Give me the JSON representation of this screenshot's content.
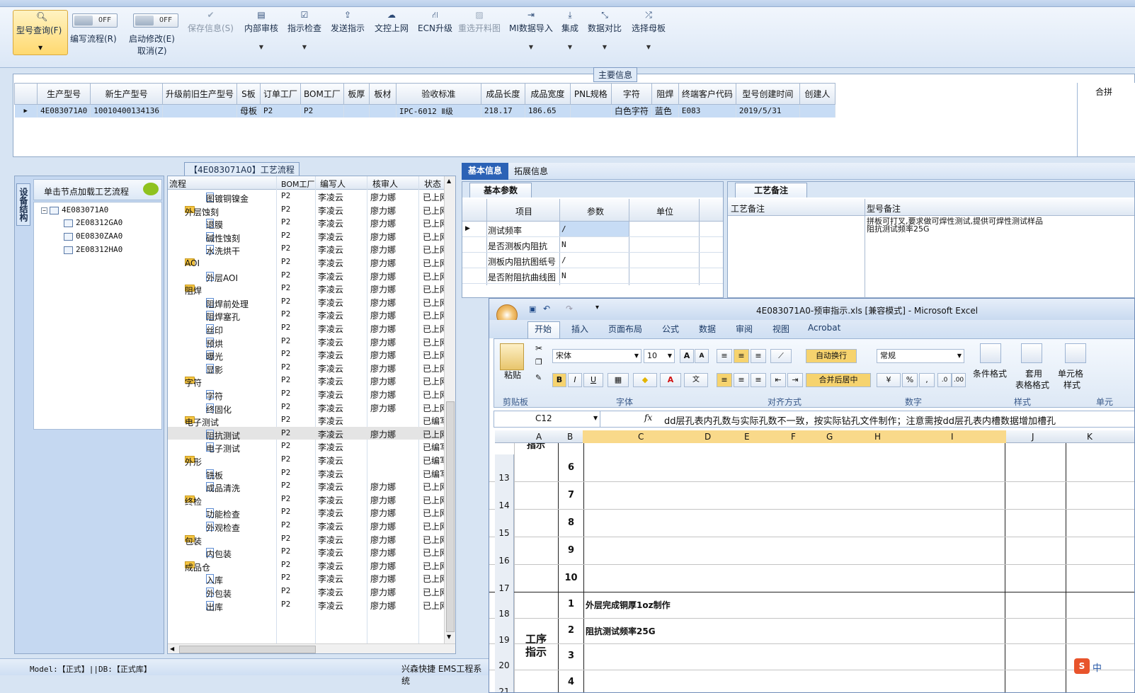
{
  "toolbar": {
    "query_label": "型号查询(F)",
    "toggle_off": "OFF",
    "write_flow": "编写流程(R)",
    "start_modify": "启动修改(E)",
    "cancel": "取消(Z)",
    "save_info": "保存信息(S)",
    "internal_review": "内部审核",
    "instr_check": "指示检查",
    "send_instr": "发送指示",
    "doc_upload": "文控上网",
    "ecn_upgrade": "ECN升级",
    "reselect_map": "重选开料图",
    "mi_import": "MI数据导入",
    "integrate": "集成",
    "data_compare": "数据对比",
    "select_mother": "选择母板"
  },
  "main_info": {
    "caption": "主要信息",
    "right_label": "合拼",
    "headers": [
      "生产型号",
      "新生产型号",
      "升级前旧生产型号",
      "S板",
      "订单工厂",
      "BOM工厂",
      "板厚",
      "板材",
      "验收标准",
      "成品长度",
      "成品宽度",
      "PNL规格",
      "字符",
      "阻焊",
      "终端客户代码",
      "型号创建时间",
      "创建人"
    ],
    "row": [
      "4E083071A0",
      "10010400134136",
      "",
      "母板",
      "P2",
      "P2",
      "",
      "",
      "IPC-6012 Ⅱ级",
      "218.17",
      "186.65",
      "",
      "白色字符",
      "蓝色",
      "E083",
      "2019/5/31",
      ""
    ]
  },
  "flow_caption": "【4E083071A0】工艺流程",
  "side": {
    "vtab": "设备结构",
    "hint": "单击节点加载工艺流程",
    "root": "4E083071A0",
    "children": [
      "2E08312GA0",
      "0E0830ZAA0",
      "2E08312HA0"
    ]
  },
  "proc": {
    "headers": [
      "流程",
      "BOM工厂",
      "编写人",
      "核审人",
      "状态"
    ],
    "rows": [
      {
        "t": "f",
        "n": "图镀铜镍金",
        "lvl": 2,
        "f": "P2",
        "w": "李凌云",
        "r": "廖力娜",
        "s": "已上网"
      },
      {
        "t": "g",
        "n": "外层蚀刻",
        "lvl": 1,
        "f": "P2",
        "w": "李凌云",
        "r": "廖力娜",
        "s": "已上网"
      },
      {
        "t": "f",
        "n": "退膜",
        "lvl": 2,
        "f": "P2",
        "w": "李凌云",
        "r": "廖力娜",
        "s": "已上网"
      },
      {
        "t": "f",
        "n": "碱性蚀刻",
        "lvl": 2,
        "f": "P2",
        "w": "李凌云",
        "r": "廖力娜",
        "s": "已上网"
      },
      {
        "t": "f",
        "n": "水洗烘干",
        "lvl": 2,
        "f": "P2",
        "w": "李凌云",
        "r": "廖力娜",
        "s": "已上网"
      },
      {
        "t": "g",
        "n": "AOI",
        "lvl": 1,
        "f": "P2",
        "w": "李凌云",
        "r": "廖力娜",
        "s": "已上网"
      },
      {
        "t": "f",
        "n": "外层AOI",
        "lvl": 2,
        "f": "P2",
        "w": "李凌云",
        "r": "廖力娜",
        "s": "已上网"
      },
      {
        "t": "g",
        "n": "阻焊",
        "lvl": 1,
        "f": "P2",
        "w": "李凌云",
        "r": "廖力娜",
        "s": "已上网"
      },
      {
        "t": "f",
        "n": "阻焊前处理",
        "lvl": 2,
        "f": "P2",
        "w": "李凌云",
        "r": "廖力娜",
        "s": "已上网"
      },
      {
        "t": "f",
        "n": "阻焊塞孔",
        "lvl": 2,
        "f": "P2",
        "w": "李凌云",
        "r": "廖力娜",
        "s": "已上网"
      },
      {
        "t": "f",
        "n": "丝印",
        "lvl": 2,
        "f": "P2",
        "w": "李凌云",
        "r": "廖力娜",
        "s": "已上网"
      },
      {
        "t": "f",
        "n": "预烘",
        "lvl": 2,
        "f": "P2",
        "w": "李凌云",
        "r": "廖力娜",
        "s": "已上网"
      },
      {
        "t": "f",
        "n": "曝光",
        "lvl": 2,
        "f": "P2",
        "w": "李凌云",
        "r": "廖力娜",
        "s": "已上网"
      },
      {
        "t": "f",
        "n": "显影",
        "lvl": 2,
        "f": "P2",
        "w": "李凌云",
        "r": "廖力娜",
        "s": "已上网"
      },
      {
        "t": "g",
        "n": "字符",
        "lvl": 1,
        "f": "P2",
        "w": "李凌云",
        "r": "廖力娜",
        "s": "已上网"
      },
      {
        "t": "f",
        "n": "字符",
        "lvl": 2,
        "f": "P2",
        "w": "李凌云",
        "r": "廖力娜",
        "s": "已上网"
      },
      {
        "t": "f",
        "n": "终固化",
        "lvl": 2,
        "f": "P2",
        "w": "李凌云",
        "r": "廖力娜",
        "s": "已上网"
      },
      {
        "t": "g",
        "n": "电子测试",
        "lvl": 1,
        "f": "P2",
        "w": "李凌云",
        "r": "",
        "s": "已编写"
      },
      {
        "t": "f",
        "n": "阻抗测试",
        "lvl": 2,
        "f": "P2",
        "w": "李凌云",
        "r": "廖力娜",
        "s": "已上网",
        "sel": true
      },
      {
        "t": "f",
        "n": "电子测试",
        "lvl": 2,
        "f": "P2",
        "w": "李凌云",
        "r": "",
        "s": "已编写"
      },
      {
        "t": "g",
        "n": "外形",
        "lvl": 1,
        "f": "P2",
        "w": "李凌云",
        "r": "",
        "s": "已编写"
      },
      {
        "t": "f",
        "n": "铣板",
        "lvl": 2,
        "f": "P2",
        "w": "李凌云",
        "r": "",
        "s": "已编写"
      },
      {
        "t": "f",
        "n": "成品清洗",
        "lvl": 2,
        "f": "P2",
        "w": "李凌云",
        "r": "廖力娜",
        "s": "已上网"
      },
      {
        "t": "g",
        "n": "终检",
        "lvl": 1,
        "f": "P2",
        "w": "李凌云",
        "r": "廖力娜",
        "s": "已上网"
      },
      {
        "t": "f",
        "n": "功能检查",
        "lvl": 2,
        "f": "P2",
        "w": "李凌云",
        "r": "廖力娜",
        "s": "已上网"
      },
      {
        "t": "f",
        "n": "外观检查",
        "lvl": 2,
        "f": "P2",
        "w": "李凌云",
        "r": "廖力娜",
        "s": "已上网"
      },
      {
        "t": "g",
        "n": "包装",
        "lvl": 1,
        "f": "P2",
        "w": "李凌云",
        "r": "廖力娜",
        "s": "已上网"
      },
      {
        "t": "f",
        "n": "内包装",
        "lvl": 2,
        "f": "P2",
        "w": "李凌云",
        "r": "廖力娜",
        "s": "已上网"
      },
      {
        "t": "g",
        "n": "成品仓",
        "lvl": 1,
        "f": "P2",
        "w": "李凌云",
        "r": "廖力娜",
        "s": "已上网"
      },
      {
        "t": "f",
        "n": "入库",
        "lvl": 2,
        "f": "P2",
        "w": "李凌云",
        "r": "廖力娜",
        "s": "已上网"
      },
      {
        "t": "f",
        "n": "外包装",
        "lvl": 2,
        "f": "P2",
        "w": "李凌云",
        "r": "廖力娜",
        "s": "已上网"
      },
      {
        "t": "f",
        "n": "出库",
        "lvl": 2,
        "f": "P2",
        "w": "李凌云",
        "r": "廖力娜",
        "s": "已上网"
      }
    ]
  },
  "info_tabs": {
    "basic": "基本信息",
    "ext": "拓展信息",
    "basic_params": "基本参数",
    "process_notes": "工艺备注"
  },
  "params": {
    "headers": [
      "项目",
      "参数",
      "单位"
    ],
    "rows": [
      [
        "测试频率",
        "/",
        ""
      ],
      [
        "是否测板内阻抗",
        "N",
        ""
      ],
      [
        "测板内阻抗图纸号",
        "/",
        ""
      ],
      [
        "是否附阻抗曲线图",
        "N",
        ""
      ]
    ]
  },
  "notes": {
    "col1": "工艺备注",
    "col2": "型号备注",
    "text1": "拼板可打叉,要求做可焊性测试,提供可焊性测试样品",
    "text2": "阻抗测试频率25G"
  },
  "excel": {
    "title": "4E083071A0-预审指示.xls  [兼容模式] - Microsoft Excel",
    "tabs": [
      "开始",
      "插入",
      "页面布局",
      "公式",
      "数据",
      "审阅",
      "视图",
      "Acrobat"
    ],
    "font": "宋体",
    "size": "10",
    "wrap": "自动换行",
    "merge": "合并后居中",
    "numfmt": "常规",
    "paste": "粘贴",
    "cond": "条件格式",
    "table_fmt_1": "套用",
    "table_fmt_2": "表格格式",
    "cell_style_1": "单元格",
    "cell_style_2": "样式",
    "groups": [
      "剪贴板",
      "字体",
      "对齐方式",
      "数字",
      "样式",
      "单元"
    ],
    "namebox": "C12",
    "formula": "dd层孔表内孔数与实际孔数不一致，按实际钻孔文件制作；注意需按dd层孔表内槽数据增加槽孔",
    "cols": [
      "A",
      "B",
      "C",
      "D",
      "E",
      "F",
      "G",
      "H",
      "I",
      "J",
      "K"
    ],
    "merged_label": "工序\n指示",
    "rows": [
      {
        "rh": "13",
        "b": "6",
        "c": ""
      },
      {
        "rh": "14",
        "b": "7",
        "c": ""
      },
      {
        "rh": "15",
        "b": "8",
        "c": ""
      },
      {
        "rh": "16",
        "b": "9",
        "c": ""
      },
      {
        "rh": "17",
        "b": "10",
        "c": ""
      },
      {
        "rh": "18",
        "b": "1",
        "c": "外层完成铜厚1oz制作"
      },
      {
        "rh": "19",
        "b": "2",
        "c": "阻抗测试频率25G"
      },
      {
        "rh": "20",
        "b": "3",
        "c": ""
      },
      {
        "rh": "21",
        "b": "4",
        "c": ""
      }
    ]
  },
  "status": {
    "left": "Model:【正式】||DB:【正式库】",
    "right": "兴森快捷 EMS工程系统"
  }
}
